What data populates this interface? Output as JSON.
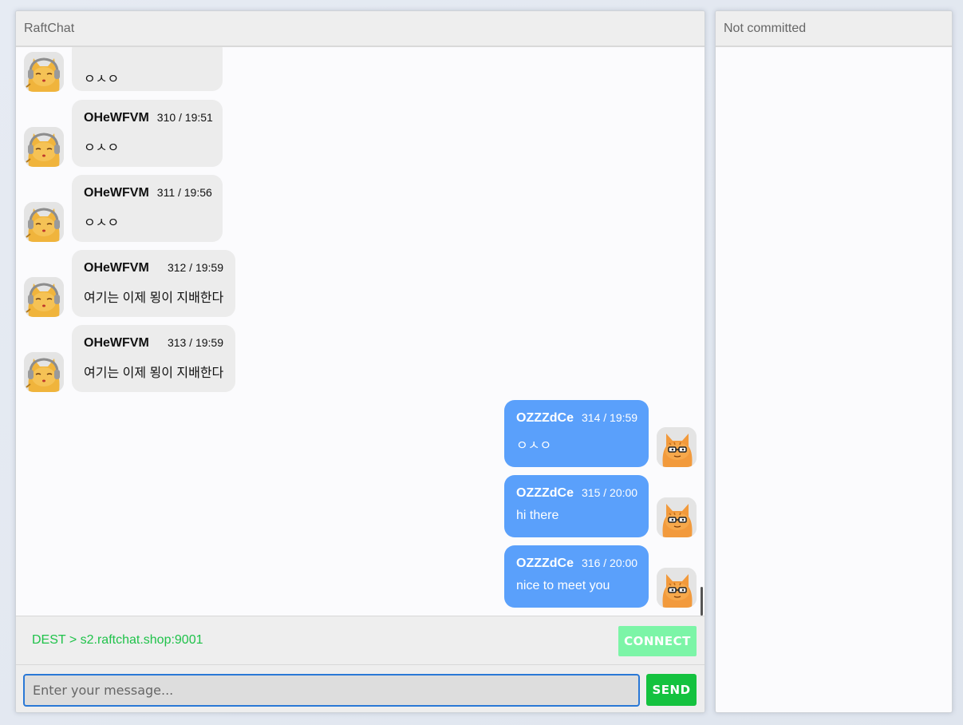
{
  "app": {
    "title": "RaftChat"
  },
  "side_panel": {
    "title": "Not committed"
  },
  "messages": [
    {
      "direction": "in",
      "name": "",
      "meta": "",
      "text": "ㅇㅅㅇ",
      "avatar": "sleeping-cat-headphones-icon"
    },
    {
      "direction": "in",
      "name": "OHeWFVM",
      "meta": "310 / 19:51",
      "text": "ㅇㅅㅇ",
      "avatar": "sleeping-cat-headphones-icon"
    },
    {
      "direction": "in",
      "name": "OHeWFVM",
      "meta": "311 / 19:56",
      "text": "ㅇㅅㅇ",
      "avatar": "sleeping-cat-headphones-icon"
    },
    {
      "direction": "in",
      "name": "OHeWFVM",
      "meta": "312 / 19:59",
      "text": "여기는 이제 묑이 지배한다",
      "avatar": "sleeping-cat-headphones-icon"
    },
    {
      "direction": "in",
      "name": "OHeWFVM",
      "meta": "313 / 19:59",
      "text": "여기는 이제 묑이 지배한다",
      "avatar": "sleeping-cat-headphones-icon"
    },
    {
      "direction": "out",
      "name": "OZZZdCe",
      "meta": "314 / 19:59",
      "text": "ㅇㅅㅇ",
      "avatar": "cat-with-glasses-icon"
    },
    {
      "direction": "out",
      "name": "OZZZdCe",
      "meta": "315 / 20:00",
      "text": "hi there",
      "avatar": "cat-with-glasses-icon"
    },
    {
      "direction": "out",
      "name": "OZZZdCe",
      "meta": "316 / 20:00",
      "text": "nice to meet you",
      "avatar": "cat-with-glasses-icon"
    }
  ],
  "dest": {
    "text": "DEST > s2.raftchat.shop:9001"
  },
  "connect": {
    "label": "CONNECT"
  },
  "composer": {
    "placeholder": "Enter your message...",
    "value": "",
    "send_label": "SEND"
  },
  "colors": {
    "incoming_bubble": "#ececec",
    "outgoing_bubble": "#5aa0fb",
    "dest_text": "#1fc24a",
    "connect_button": "#7cf5a7",
    "send_button": "#14c23f",
    "input_focus_border": "#2a78d6"
  }
}
